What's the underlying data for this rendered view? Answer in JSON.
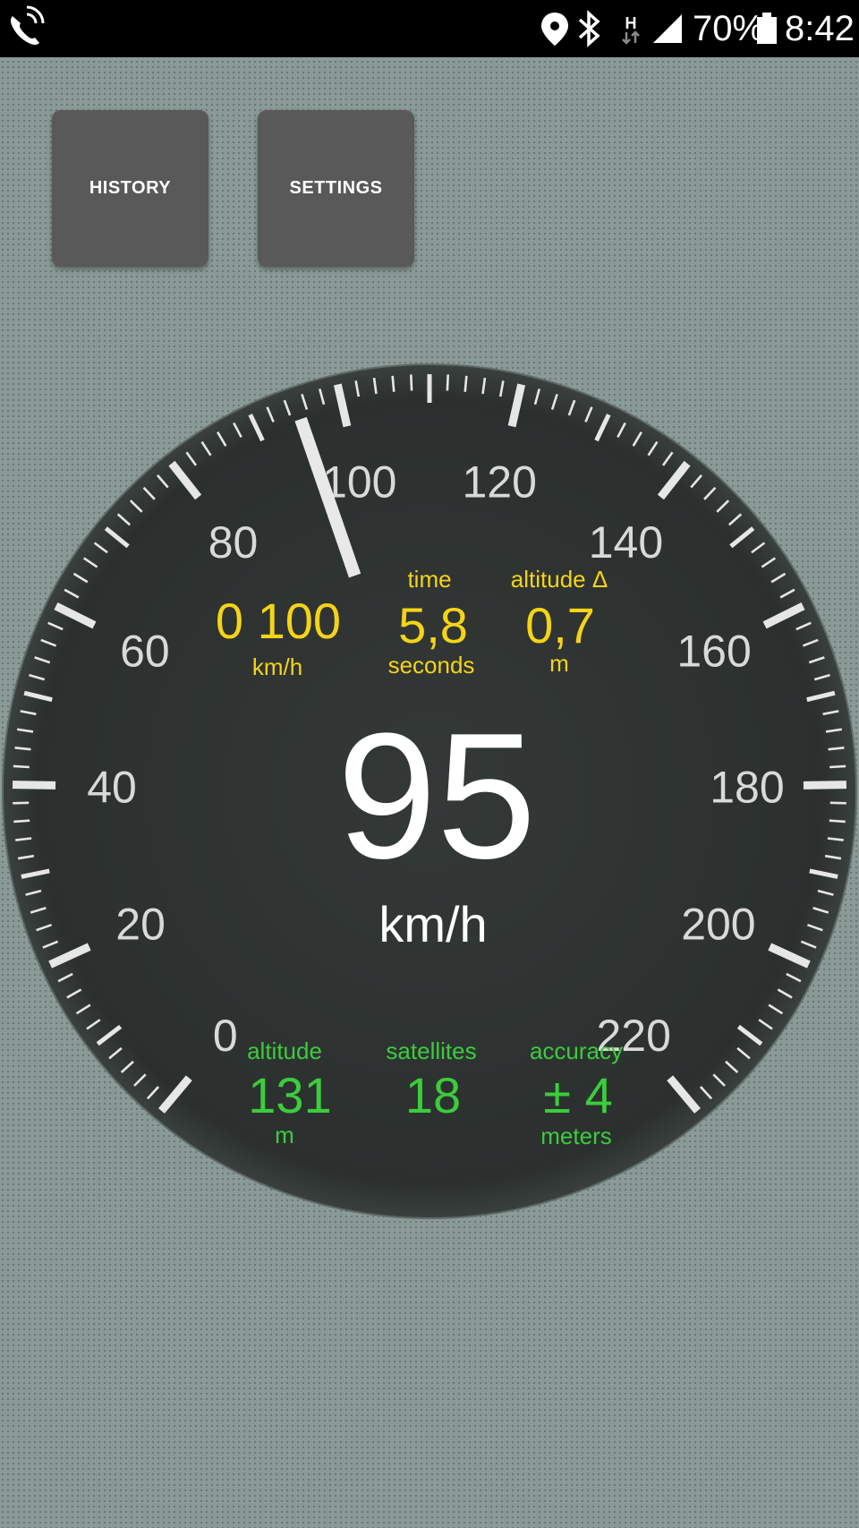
{
  "status_bar": {
    "network_type": "H",
    "battery_percent": "70%",
    "time": "8:42",
    "icons": [
      "wifi-calling-icon",
      "location-icon",
      "bluetooth-icon",
      "data-arrows-icon",
      "signal-icon",
      "battery-icon"
    ]
  },
  "buttons": {
    "history_label": "HISTORY",
    "settings_label": "SETTINGS"
  },
  "gauge": {
    "scale_labels": [
      "0",
      "20",
      "40",
      "60",
      "80",
      "100",
      "120",
      "140",
      "160",
      "180",
      "200",
      "220"
    ],
    "scale_max": 220,
    "needle_value": 95,
    "speed": "95",
    "speed_unit": "km/h",
    "top_stats": [
      {
        "caption": "",
        "value": "0 100",
        "unit": "km/h"
      },
      {
        "caption": "time",
        "value": "5,8",
        "unit": "seconds"
      },
      {
        "caption": "altitude Δ",
        "value": "0,7",
        "unit": "m"
      }
    ],
    "bottom_stats": [
      {
        "caption": "altitude",
        "value": "131",
        "unit": "m"
      },
      {
        "caption": "satellites",
        "value": "18",
        "unit": ""
      },
      {
        "caption": "accuracy",
        "value": "± 4",
        "unit": "meters"
      }
    ],
    "colors": {
      "dial": "#2e3332",
      "ticks": "#e6e6e6",
      "top_stats": "#f5d416",
      "bottom_stats": "#3ccc3c",
      "speed": "#ffffff"
    }
  }
}
